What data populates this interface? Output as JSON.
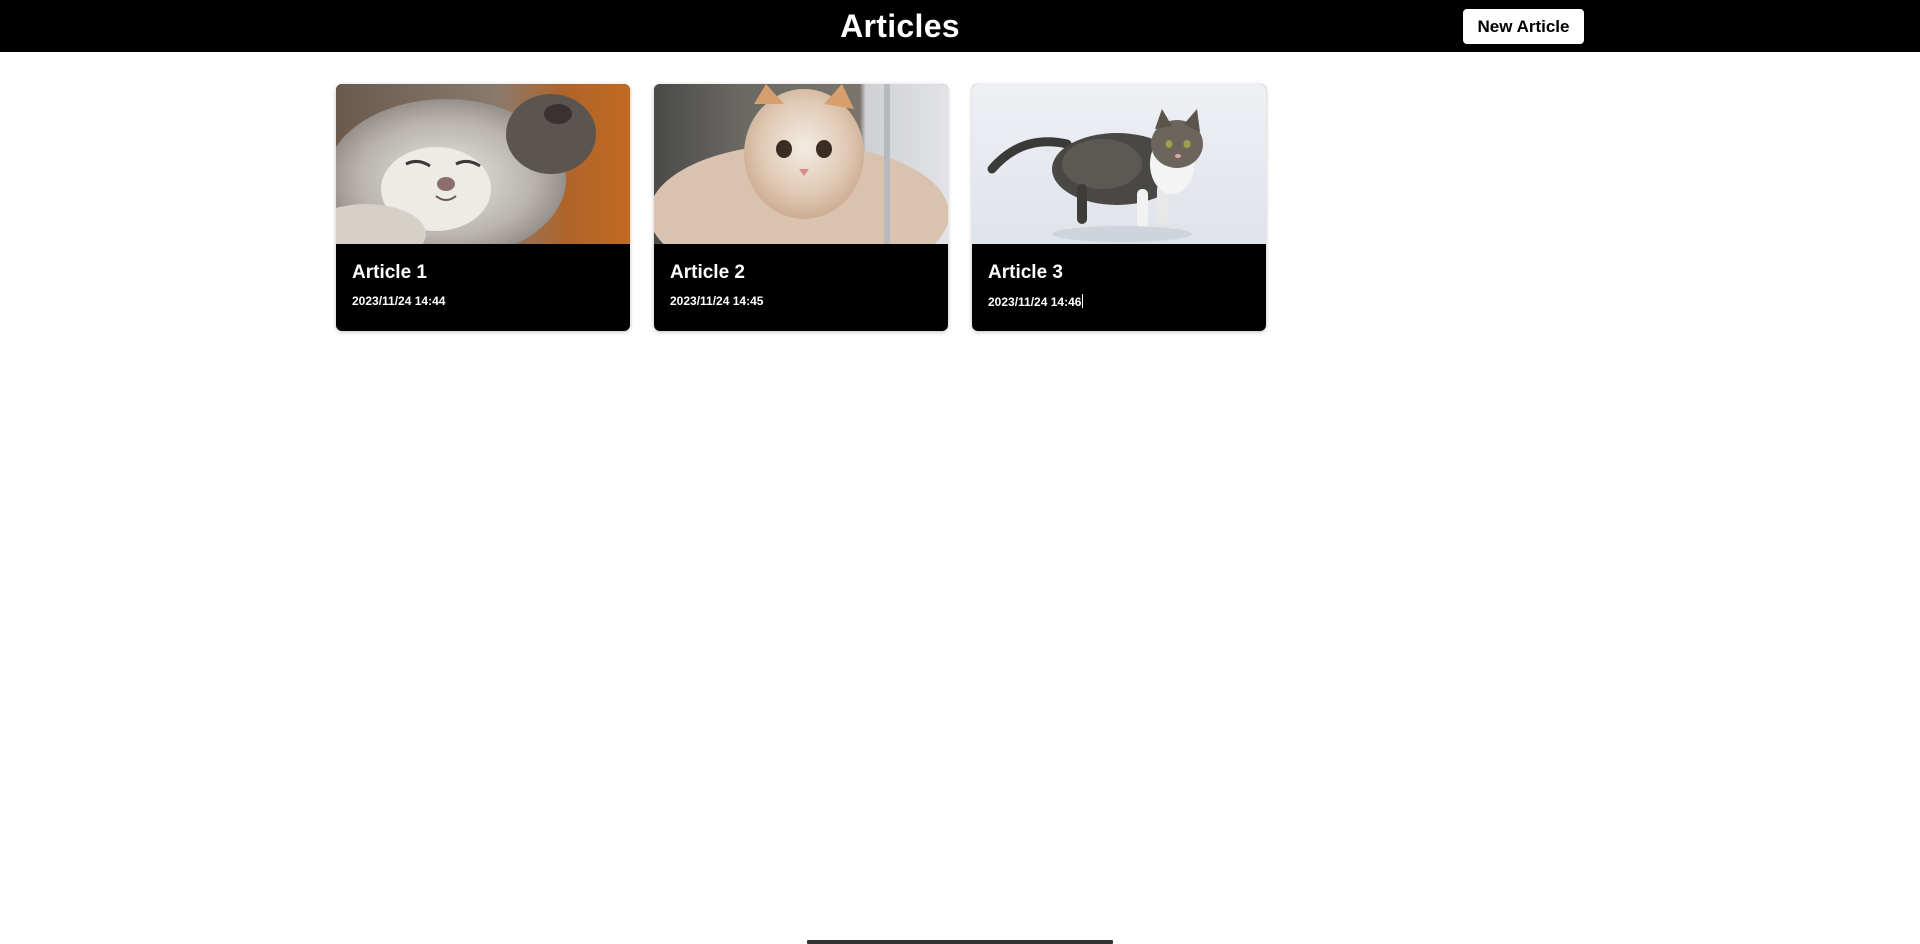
{
  "header": {
    "title": "Articles",
    "new_article_label": "New Article"
  },
  "articles": [
    {
      "title": "Article 1",
      "date": "2023/11/24 14:44",
      "image": "kitten-sleeping-image"
    },
    {
      "title": "Article 2",
      "date": "2023/11/24 14:45",
      "image": "kitten-cream-image"
    },
    {
      "title": "Article 3",
      "date": "2023/11/24 14:46",
      "image": "cat-in-snow-image"
    }
  ],
  "colors": {
    "header_bg": "#000000",
    "card_bg": "#000000",
    "text_on_dark": "#ffffff",
    "page_bg": "#ffffff"
  }
}
